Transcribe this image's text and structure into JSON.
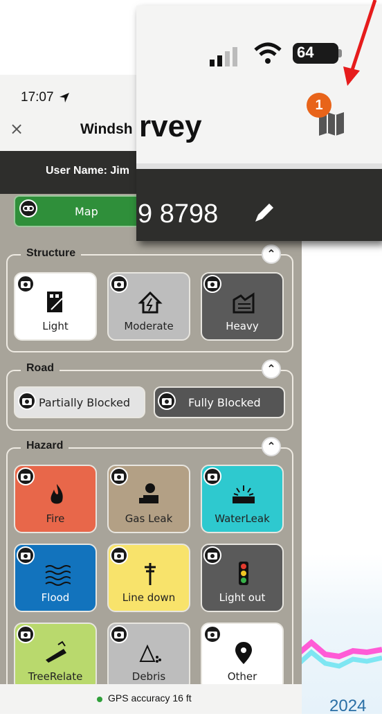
{
  "status": {
    "time": "17:07"
  },
  "header": {
    "close": "×",
    "title": "Windsh"
  },
  "user": {
    "label": "User Name: Jim"
  },
  "map_button": {
    "label": "Map"
  },
  "zoom_callout": {
    "title": "rvey",
    "code": "9 8798",
    "battery": "64",
    "badge": "1"
  },
  "sections": {
    "structure": {
      "title": "Structure",
      "tiles": [
        {
          "label": "Light",
          "bg": "#ffffff",
          "fg": "#222222",
          "icon": "building-light-icon"
        },
        {
          "label": "Moderate",
          "bg": "#bdbdbd",
          "fg": "#222222",
          "icon": "house-damage-icon"
        },
        {
          "label": "Heavy",
          "bg": "#5a5a5a",
          "fg": "#ffffff",
          "icon": "building-collapse-icon"
        }
      ]
    },
    "road": {
      "title": "Road",
      "buttons": [
        {
          "label": "Partially Blocked",
          "bg": "#e4e4e4",
          "fg": "#222222"
        },
        {
          "label": "Fully Blocked",
          "bg": "#555555",
          "fg": "#ffffff"
        }
      ]
    },
    "hazard": {
      "title": "Hazard",
      "tiles": [
        {
          "label": "Fire",
          "bg": "#e8674a",
          "fg": "#222222",
          "icon": "fire-icon"
        },
        {
          "label": "Gas Leak",
          "bg": "#b3a085",
          "fg": "#222222",
          "icon": "gas-leak-icon"
        },
        {
          "label": "WaterLeak",
          "bg": "#2ec9cf",
          "fg": "#222222",
          "icon": "water-leak-icon"
        },
        {
          "label": "Flood",
          "bg": "#1273bd",
          "fg": "#ffffff",
          "icon": "flood-icon"
        },
        {
          "label": "Line down",
          "bg": "#f8e36b",
          "fg": "#222222",
          "icon": "power-line-icon"
        },
        {
          "label": "Light out",
          "bg": "#5a5a5a",
          "fg": "#ffffff",
          "icon": "traffic-light-icon"
        },
        {
          "label": "TreeRelate",
          "bg": "#b9d96d",
          "fg": "#222222",
          "icon": "tree-icon"
        },
        {
          "label": "Debris",
          "bg": "#bdbdbd",
          "fg": "#222222",
          "icon": "debris-icon"
        },
        {
          "label": "Other",
          "bg": "#ffffff",
          "fg": "#222222",
          "icon": "location-pin-icon"
        }
      ]
    }
  },
  "gps": {
    "label": "GPS accuracy 16 ft"
  },
  "background": {
    "year": "2024"
  }
}
